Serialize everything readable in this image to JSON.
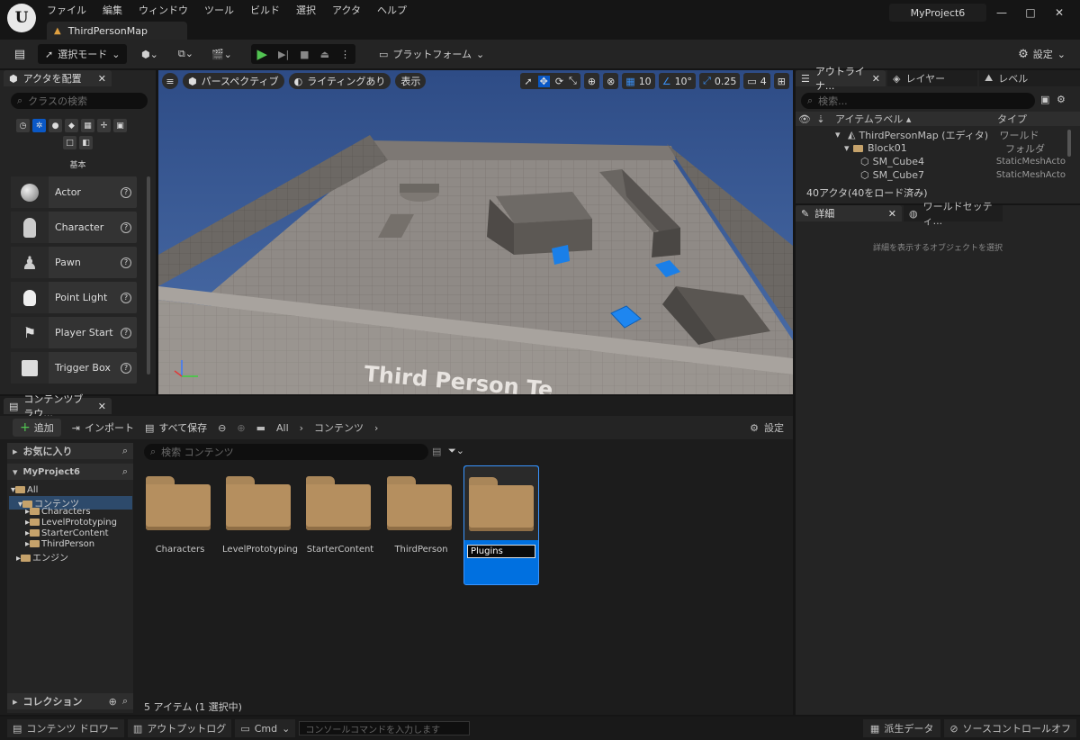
{
  "app": {
    "logo_glyph": "U",
    "project": "MyProject6",
    "map_tab": "ThirdPersonMap"
  },
  "menu": [
    "ファイル",
    "編集",
    "ウィンドウ",
    "ツール",
    "ビルド",
    "選択",
    "アクタ",
    "ヘルプ"
  ],
  "toolbar": {
    "select_mode": "選択モード",
    "platform": "プラットフォーム",
    "settings": "設定"
  },
  "place_actors": {
    "tab": "アクタを配置",
    "search_placeholder": "クラスの検索",
    "category": "基本",
    "items": [
      "Actor",
      "Character",
      "Pawn",
      "Point Light",
      "Player Start",
      "Trigger Box"
    ]
  },
  "viewport": {
    "perspective": "パースペクティブ",
    "lighting": "ライティングあり",
    "show": "表示",
    "grid_snap": "10",
    "rot_snap": "10°",
    "scale_snap": "0.25",
    "camera_speed": "4",
    "overlay_text": "Third Person Te"
  },
  "outliner": {
    "tabs": [
      "アウトライナ...",
      "レイヤー",
      "レベル"
    ],
    "search_placeholder": "検索...",
    "col_label": "アイテムラベル ▴",
    "col_type": "タイプ",
    "rows": [
      {
        "label": "ThirdPersonMap (エディタ)",
        "type": "ワールド"
      },
      {
        "label": "Block01",
        "type": "フォルダ"
      },
      {
        "label": "SM_Cube4",
        "type": "StaticMeshActo"
      },
      {
        "label": "SM_Cube7",
        "type": "StaticMeshActo"
      }
    ],
    "status": "40アクタ(40をロード済み)"
  },
  "details": {
    "tabs": [
      "詳細",
      "ワールドセッティ..."
    ],
    "empty_hint": "詳細を表示するオブジェクトを選択"
  },
  "content_browser": {
    "tab": "コンテンツブラウ...",
    "add": "追加",
    "import": "インポート",
    "save_all": "すべて保存",
    "path": [
      "All",
      "コンテンツ"
    ],
    "settings": "設定",
    "favorites": "お気に入り",
    "project": "MyProject6",
    "tree": [
      "All",
      "コンテンツ",
      "Characters",
      "LevelPrototyping",
      "StarterContent",
      "ThirdPerson",
      "エンジン"
    ],
    "search_placeholder": "検索 コンテンツ",
    "folders": [
      "Characters",
      "LevelPrototyping",
      "StarterContent",
      "ThirdPerson",
      "Plugins"
    ],
    "collections": "コレクション",
    "item_count": "5 アイテム (1 選択中)"
  },
  "statusbar": {
    "drawer": "コンテンツ ドロワー",
    "output_log": "アウトプットログ",
    "cmd": "Cmd",
    "console_placeholder": "コンソールコマンドを入力します",
    "derived_data": "派生データ",
    "source_control": "ソースコントロールオフ"
  },
  "colors": {
    "selection": "#0070e0",
    "accent_green": "#52c452",
    "cube_blue": "#1a7fe8"
  }
}
